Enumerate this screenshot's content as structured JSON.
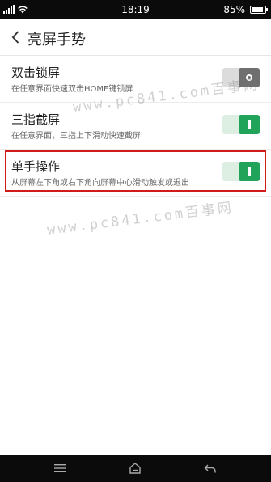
{
  "status_bar": {
    "time": "18:19",
    "battery_percent": "85%",
    "battery_level": 0.85
  },
  "header": {
    "title": "亮屏手势"
  },
  "settings": [
    {
      "title": "双击锁屏",
      "description": "在任意界面快速双击HOME键锁屏",
      "enabled": false
    },
    {
      "title": "三指截屏",
      "description": "在任意界面，三指上下滑动快速截屏",
      "enabled": true
    },
    {
      "title": "单手操作",
      "description": "从屏幕左下角或右下角向屏幕中心滑动触发或退出",
      "enabled": true
    }
  ],
  "watermarks": [
    {
      "text": "www.pc841.com",
      "text2": "百事网"
    },
    {
      "text": "www.pc841.com",
      "text2": "百事网"
    }
  ],
  "colors": {
    "accent": "#22a35a",
    "highlight": "#d11a1a"
  },
  "icons": {
    "back": "chevron-left-icon",
    "menu": "menu-icon",
    "home": "home-icon",
    "return": "return-icon"
  }
}
